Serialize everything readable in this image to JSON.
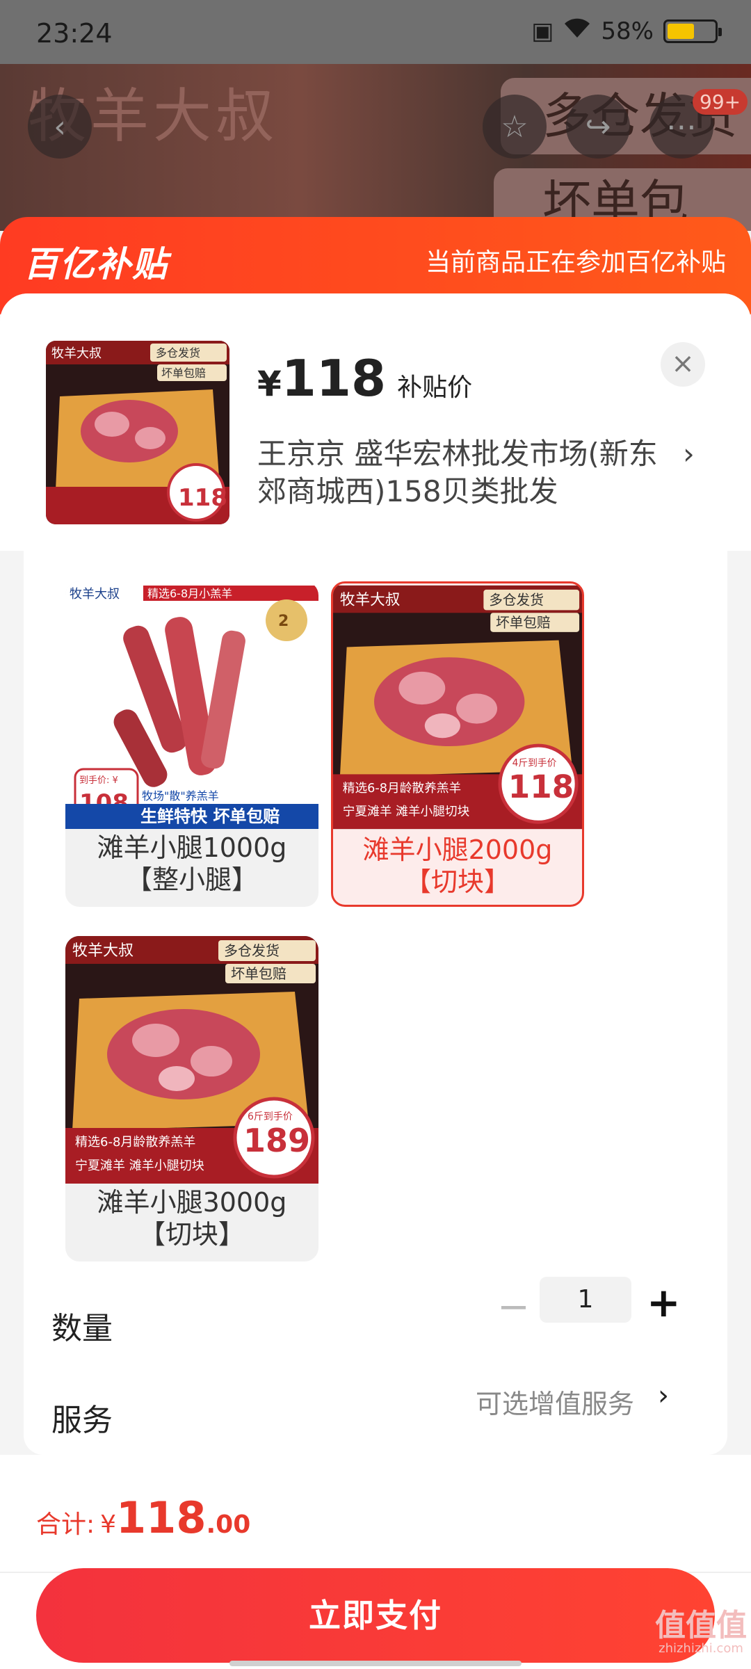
{
  "status_bar": {
    "time": "23:24",
    "battery": "58%",
    "battery_level": 0.58
  },
  "banner": {
    "logo": "牧羊大叔",
    "promo_1": "多仓发货",
    "promo_2": "坏单包",
    "cart_badge": "99+"
  },
  "subsidy": {
    "brand": "百亿补贴",
    "note": "当前商品正在参加百亿补贴"
  },
  "product": {
    "currency": "¥",
    "price": "118",
    "price_tag": "补贴价",
    "store": "王京京  盛华宏林批发市场(新东郊商城西)158贝类批发",
    "thumb_price": "118"
  },
  "skus": [
    {
      "label_line1": "滩羊小腿1000g",
      "label_line2": "【整小腿】",
      "img_price_caption": "到手价: ¥",
      "img_price": "108",
      "img_banner": "生鲜特快 坏单包赔",
      "img_sub": "牧场\"散\"养羔羊",
      "img_topline": "精选6-8月小羔羊",
      "selected": false
    },
    {
      "label_line1": "滩羊小腿2000g",
      "label_line2": "【切块】",
      "img_badge_caption": "4斤到手价",
      "img_price": "118",
      "img_line1": "精选6-8月龄散养羔羊",
      "img_line2": "宁夏滩羊  滩羊小腿切块",
      "selected": true
    },
    {
      "label_line1": "滩羊小腿3000g",
      "label_line2": "【切块】",
      "img_badge_caption": "6斤到手价",
      "img_price": "189",
      "img_line1": "精选6-8月龄散养羔羊",
      "img_line2": "宁夏滩羊  滩羊小腿切块",
      "selected": false
    }
  ],
  "img_tags": {
    "tag1": "多仓发货",
    "tag2": "坏单包赔"
  },
  "quantity": {
    "label": "数量",
    "value": "1"
  },
  "service": {
    "label": "服务",
    "value": "可选增值服务"
  },
  "total": {
    "label": "合计:",
    "currency": "¥",
    "integer": "118",
    "decimal": ".00"
  },
  "pay_button": "立即支付",
  "watermark": {
    "text": "值值值",
    "sub": "zhizhizhi.com"
  },
  "colors": {
    "accent": "#e8392c",
    "subsidy": "#ff4a1f"
  }
}
